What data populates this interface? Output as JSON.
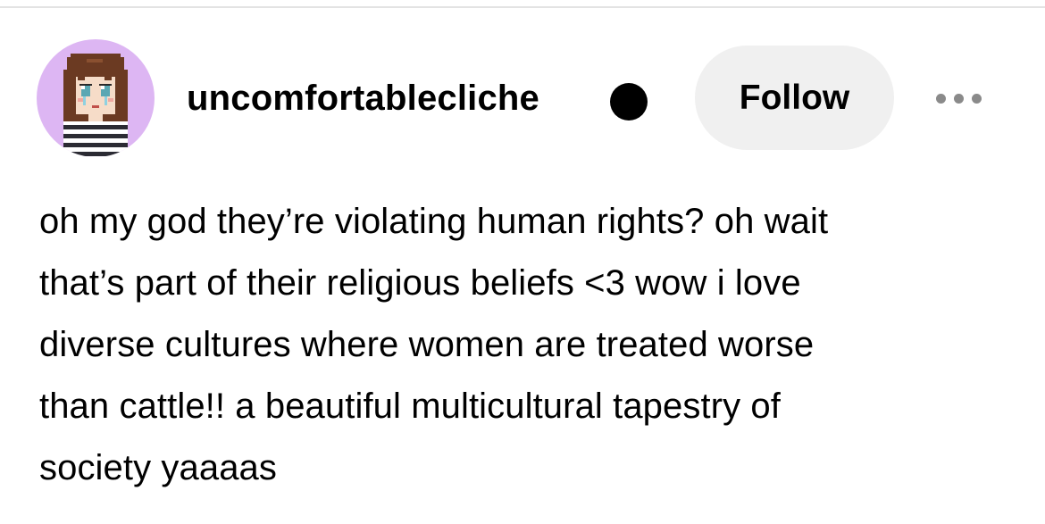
{
  "post": {
    "username": "uncomfortablecliche",
    "follow_label": "Follow",
    "more_icon": "ellipsis-icon",
    "avatar_icon": "pixel-art-girl-avatar",
    "body_lines": [
      "oh my god they’re violating human rights? oh wait",
      "that’s part of their religious beliefs <3 wow i love",
      "diverse cultures where women are treated worse",
      "than cattle!! a beautiful multicultural tapestry of",
      "society yaaaas"
    ]
  },
  "colors": {
    "avatar_bg": "#ddb6f3",
    "follow_bg": "#f0f0f0",
    "text": "#000000",
    "more_dots": "#8a8a8a"
  }
}
